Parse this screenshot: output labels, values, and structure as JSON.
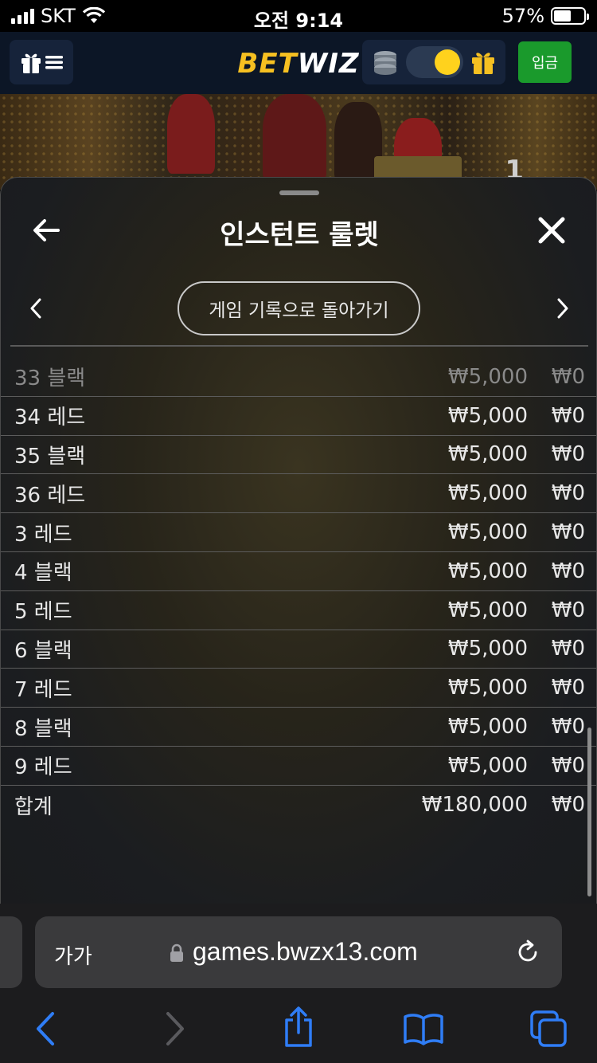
{
  "status": {
    "carrier": "SKT",
    "time": "오전 9:14",
    "battery": "57%",
    "battery_level": 0.57
  },
  "header": {
    "logo_bet": "BET",
    "logo_wiz": "WIZ",
    "deposit_label": "입금"
  },
  "casino": {
    "number": "1"
  },
  "sheet": {
    "title": "인스턴트 룰렛",
    "back_to_history": "게임 기록으로 돌아가기",
    "rows": [
      {
        "label": "33 블랙",
        "bet": "₩5,000",
        "win": "₩0"
      },
      {
        "label": "34 레드",
        "bet": "₩5,000",
        "win": "₩0"
      },
      {
        "label": "35 블랙",
        "bet": "₩5,000",
        "win": "₩0"
      },
      {
        "label": "36 레드",
        "bet": "₩5,000",
        "win": "₩0"
      },
      {
        "label": "3 레드",
        "bet": "₩5,000",
        "win": "₩0"
      },
      {
        "label": "4 블랙",
        "bet": "₩5,000",
        "win": "₩0"
      },
      {
        "label": "5 레드",
        "bet": "₩5,000",
        "win": "₩0"
      },
      {
        "label": "6 블랙",
        "bet": "₩5,000",
        "win": "₩0"
      },
      {
        "label": "7 레드",
        "bet": "₩5,000",
        "win": "₩0"
      },
      {
        "label": "8 블랙",
        "bet": "₩5,000",
        "win": "₩0"
      },
      {
        "label": "9 레드",
        "bet": "₩5,000",
        "win": "₩0"
      }
    ],
    "total": {
      "label": "합계",
      "bet": "₩180,000",
      "win": "₩0"
    }
  },
  "browser": {
    "aa_label": "가가",
    "url": "games.bwzx13.com"
  },
  "colors": {
    "brand_yellow": "#f6c021",
    "deposit_green": "#1a9a2c",
    "header_bg": "#0c1626"
  }
}
